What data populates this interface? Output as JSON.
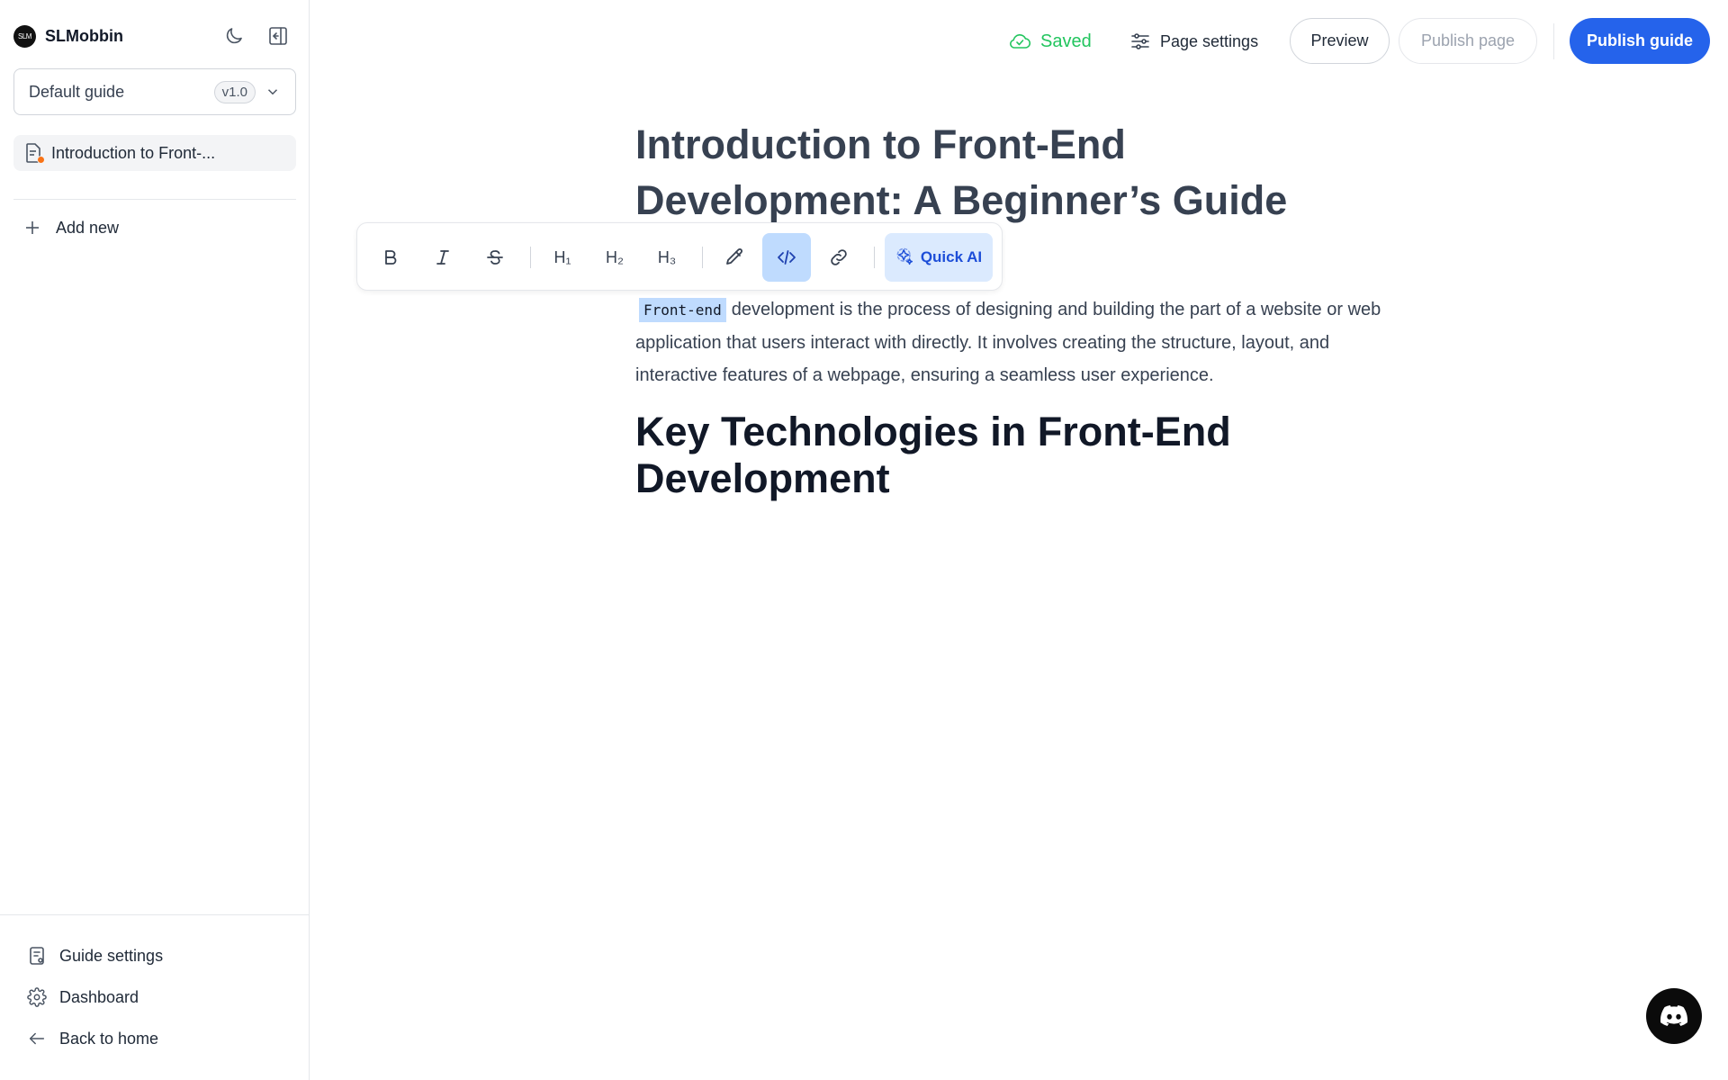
{
  "sidebar": {
    "brand_logo_text": "SLM",
    "brand_name": "SLMobbin",
    "guide_select": {
      "label": "Default guide",
      "version": "v1.0"
    },
    "pages": [
      {
        "label": "Introduction to Front-..."
      }
    ],
    "add_new_label": "Add new",
    "bottom_links": {
      "guide_settings": "Guide settings",
      "dashboard": "Dashboard",
      "back_home": "Back to home"
    }
  },
  "topbar": {
    "saved_label": "Saved",
    "page_settings_label": "Page settings",
    "preview_label": "Preview",
    "publish_page_label": "Publish page",
    "publish_guide_label": "Publish guide"
  },
  "toolbar": {
    "h1": "H₁",
    "h2": "H₂",
    "h3": "H₃",
    "quick_ai_label": "Quick AI"
  },
  "document": {
    "title": "Introduction to Front-End Development: A Beginner’s Guide",
    "paragraph_code": "Front-end",
    "paragraph_rest": "development is the process of designing and building the part of a website or web application that users interact with directly. It involves creating the structure, layout, and interactive features of a webpage, ensuring a seamless user experience.",
    "heading2": "Key Technologies in Front-End Development"
  },
  "colors": {
    "accent": "#2563eb",
    "saved": "#22c55e",
    "code_highlight": "#bfdbfe",
    "page_dot": "#f97316"
  },
  "icons": [
    "moon-icon",
    "collapse-sidebar-icon",
    "chevron-down-icon",
    "document-icon",
    "plus-icon",
    "guide-settings-icon",
    "gear-icon",
    "arrow-left-icon",
    "cloud-check-icon",
    "sliders-icon",
    "bold-icon",
    "italic-icon",
    "strikethrough-icon",
    "pencil-icon",
    "code-icon",
    "link-icon",
    "sparkle-icon",
    "discord-icon"
  ]
}
